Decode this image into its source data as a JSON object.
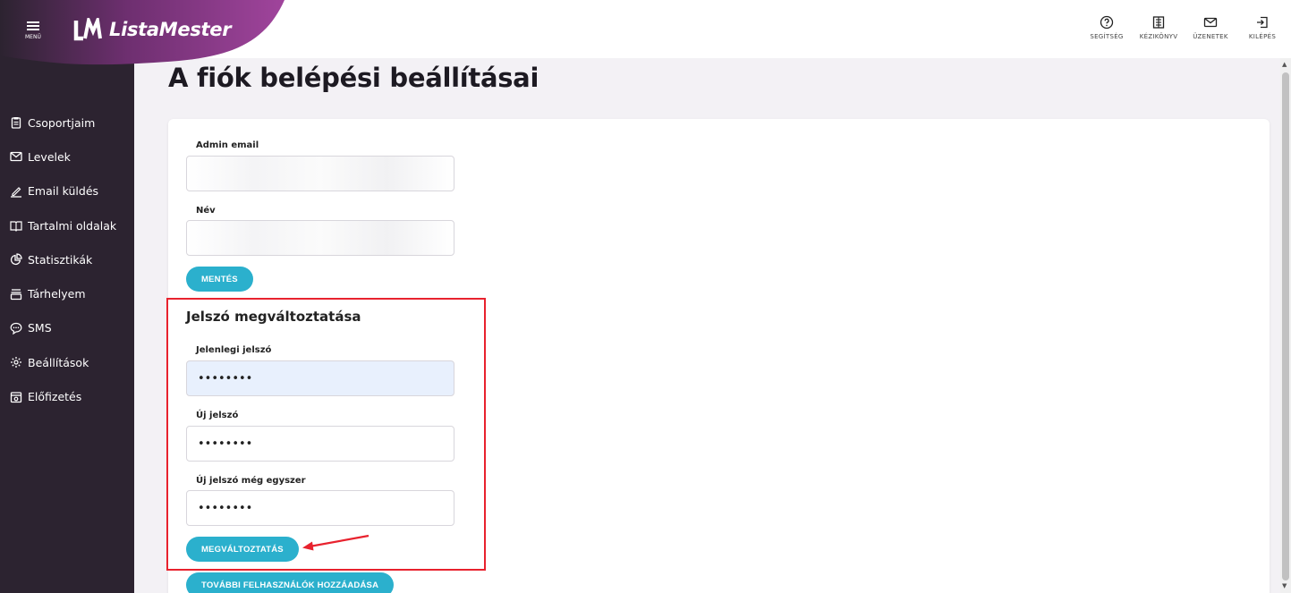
{
  "app": {
    "menu_label": "MENÜ",
    "brand_name": "ListaMester"
  },
  "top_nav": [
    {
      "label": "SEGÍTSÉG",
      "icon": "help-circle-icon"
    },
    {
      "label": "KÉZIKÖNYV",
      "icon": "book-icon"
    },
    {
      "label": "ÜZENETEK",
      "icon": "envelope-icon"
    },
    {
      "label": "KILÉPÉS",
      "icon": "logout-icon"
    }
  ],
  "sidebar": {
    "items": [
      {
        "label": "Csoportjaim",
        "icon": "clipboard-icon"
      },
      {
        "label": "Levelek",
        "icon": "envelope-icon"
      },
      {
        "label": "Email küldés",
        "icon": "pencil-icon"
      },
      {
        "label": "Tartalmi oldalak",
        "icon": "open-book-icon"
      },
      {
        "label": "Statisztikák",
        "icon": "pie-chart-icon"
      },
      {
        "label": "Tárhelyem",
        "icon": "storage-icon"
      },
      {
        "label": "SMS",
        "icon": "chat-bubble-icon"
      },
      {
        "label": "Beállítások",
        "icon": "gear-icon"
      },
      {
        "label": "Előfizetés",
        "icon": "subscription-icon"
      }
    ]
  },
  "page": {
    "title": "A fiók belépési beállításai"
  },
  "account_form": {
    "admin_email_label": "Admin email",
    "admin_email_value": "",
    "name_label": "Név",
    "name_value": "",
    "save_button": "MENTÉS"
  },
  "password_form": {
    "title": "Jelszó megváltoztatása",
    "current_label": "Jelenlegi jelszó",
    "current_value": "••••••••",
    "new_label": "Új jelszó",
    "new_value": "••••••••",
    "repeat_label": "Új jelszó még egyszer",
    "repeat_value": "••••••••",
    "change_button": "MEGVÁLTOZTATÁS"
  },
  "extra": {
    "add_users_button": "TOVÁBBI FELHASZNÁLÓK HOZZÁADÁSA"
  },
  "colors": {
    "sidebar_bg": "#2c2330",
    "accent": "#2bb0cd",
    "brand_purple": "#8e3a8a",
    "highlight_red": "#e8222e"
  }
}
